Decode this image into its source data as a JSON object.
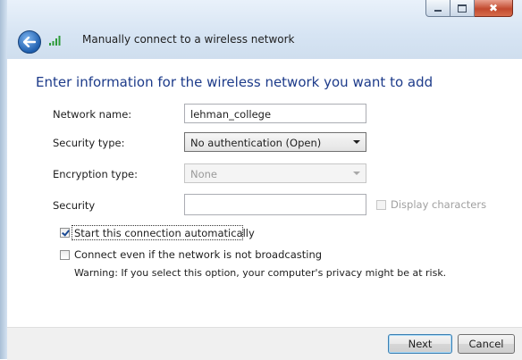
{
  "window": {
    "title": "Manually connect to a wireless network",
    "controls": {
      "minimize": "minimize",
      "maximize": "maximize",
      "close": "✖"
    }
  },
  "heading": "Enter information for the wireless network you want to add",
  "form": {
    "network_name": {
      "label": "Network name:",
      "value": "lehman_college"
    },
    "security_type": {
      "label": "Security type:",
      "value": "No authentication (Open)"
    },
    "encryption_type": {
      "label": "Encryption type:",
      "value": "None"
    },
    "security_key": {
      "label": "Security",
      "value": "",
      "display_characters_label": "Display characters",
      "display_characters_checked": false
    }
  },
  "options": {
    "start_auto": {
      "label": "Start this connection automatically",
      "checked": true
    },
    "connect_even": {
      "label": "Connect even if the network is not broadcasting",
      "checked": false
    },
    "warning": "Warning: If you select this option, your computer's privacy might be at risk."
  },
  "buttons": {
    "next": "Next",
    "cancel": "Cancel"
  },
  "colors": {
    "heading": "#1d3b8a",
    "titlebar": "#d6e4f3",
    "close_button": "#c24a2f"
  },
  "icons": {
    "back": "back-arrow-icon",
    "network": "wireless-signal-icon"
  }
}
